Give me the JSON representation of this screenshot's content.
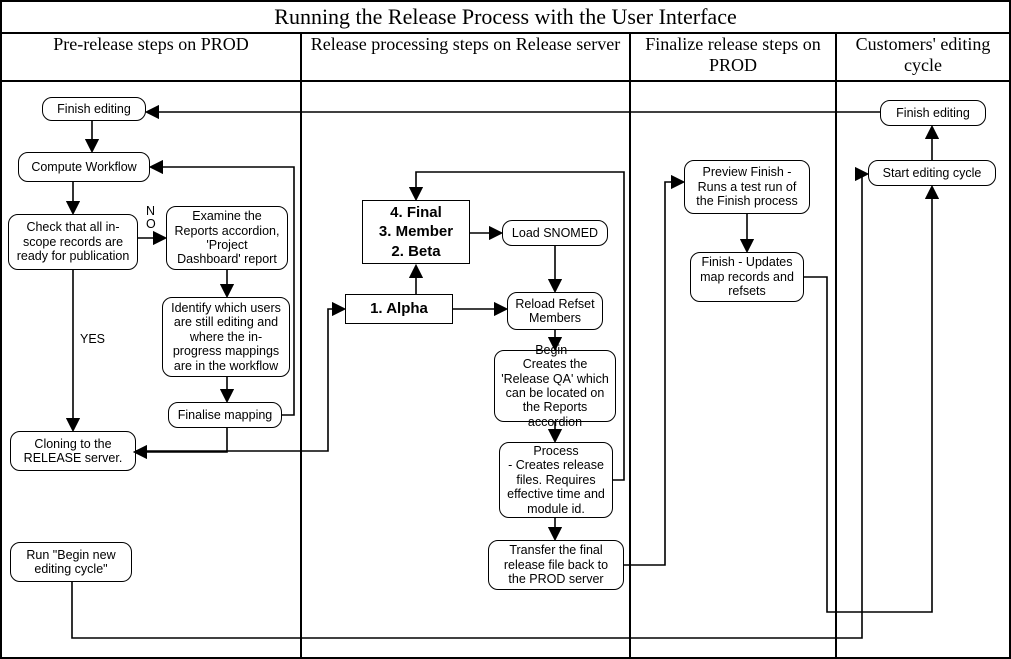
{
  "title": "Running the Release Process with the User Interface",
  "columns": {
    "c1": "Pre-release steps on PROD",
    "c2": "Release processing steps on Release server",
    "c3": "Finalize release steps on PROD",
    "c4": "Customers' editing cycle"
  },
  "nodes": {
    "finish_editing1": "Finish editing",
    "compute_workflow": "Compute Workflow",
    "check_inscope": "Check that all in-scope records are ready for publication",
    "examine_reports": "Examine the Reports accordion, 'Project Dashboard' report",
    "identify_users": "Identify which users are still editing and where the in-progress mappings are in the workflow",
    "finalise_mapping": "Finalise mapping",
    "cloning": "Cloning to the RELEASE server.",
    "begin_new": "Run \"Begin new editing cycle\"",
    "stages_top": "4. Final\n3. Member\n2. Beta",
    "stages_alpha": "1. Alpha",
    "load_snomed": "Load SNOMED",
    "reload_refset": "Reload Refset Members",
    "begin_qa": "Begin -\nCreates the 'Release QA' which can be located on the Reports accordion",
    "process": "Process\n- Creates release files. Requires effective time and module id.",
    "transfer": "Transfer the final release file back to the PROD server",
    "preview_finish": "Preview Finish - Runs a test run of the Finish process",
    "finish_updates": "Finish - Updates map records and refsets",
    "start_editing": "Start editing cycle",
    "finish_editing2": "Finish editing"
  },
  "labels": {
    "yes": "YES",
    "no": "NO"
  }
}
